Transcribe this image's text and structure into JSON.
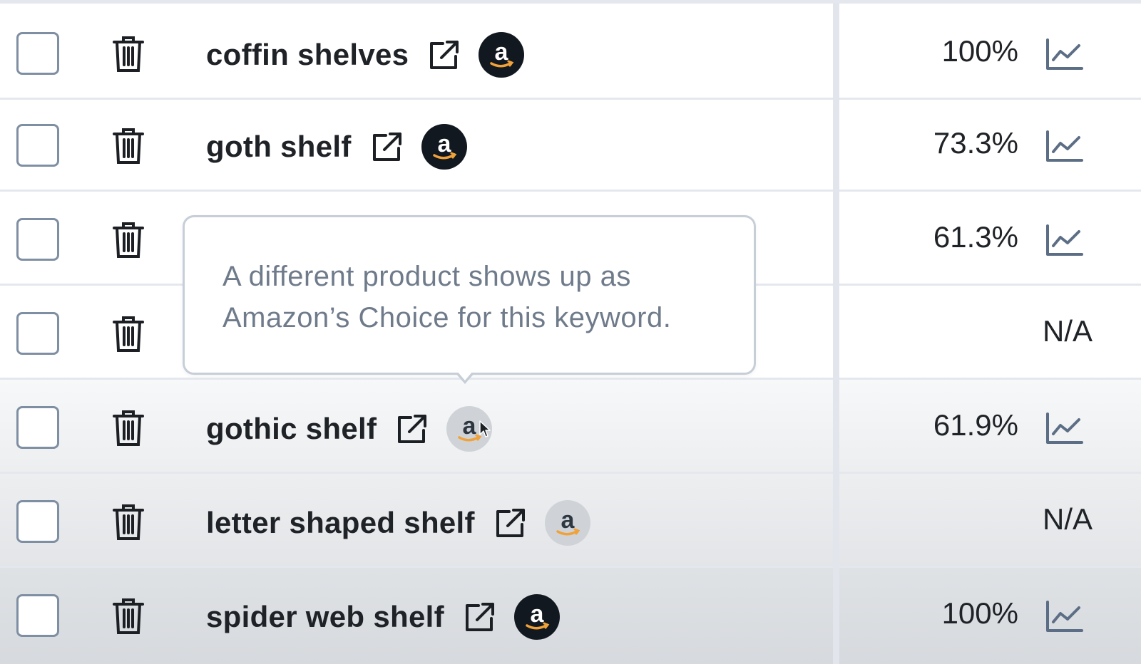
{
  "rows": [
    {
      "keyword": "coffin shelves",
      "score": "100%",
      "amazon_choice": true
    },
    {
      "keyword": "goth shelf",
      "score": "73.3%",
      "amazon_choice": true
    },
    {
      "keyword": "",
      "score": "61.3%",
      "amazon_choice": null
    },
    {
      "keyword": "",
      "score": "N/A",
      "amazon_choice": null
    },
    {
      "keyword": "gothic shelf",
      "score": "61.9%",
      "amazon_choice": false
    },
    {
      "keyword": "letter shaped shelf",
      "score": "N/A",
      "amazon_choice": false
    },
    {
      "keyword": "spider web shelf",
      "score": "100%",
      "amazon_choice": true
    }
  ],
  "tooltip": {
    "text": "A different product shows up as Amazon’s Choice for this keyword."
  },
  "icons": {
    "delete": "trash-icon",
    "open": "external-link-icon",
    "amazon": "amazon-logo-icon",
    "trend": "trend-chart-icon"
  },
  "colors": {
    "text": "#1f2226",
    "checkbox_border": "#7f8fa3",
    "amazon_active_bg": "#12181f",
    "amazon_inactive_bg": "#cfd3d8",
    "amazon_smile": "#f0a23a",
    "tooltip_text": "#6f7b8b",
    "trend_icon": "#5c6e85"
  }
}
